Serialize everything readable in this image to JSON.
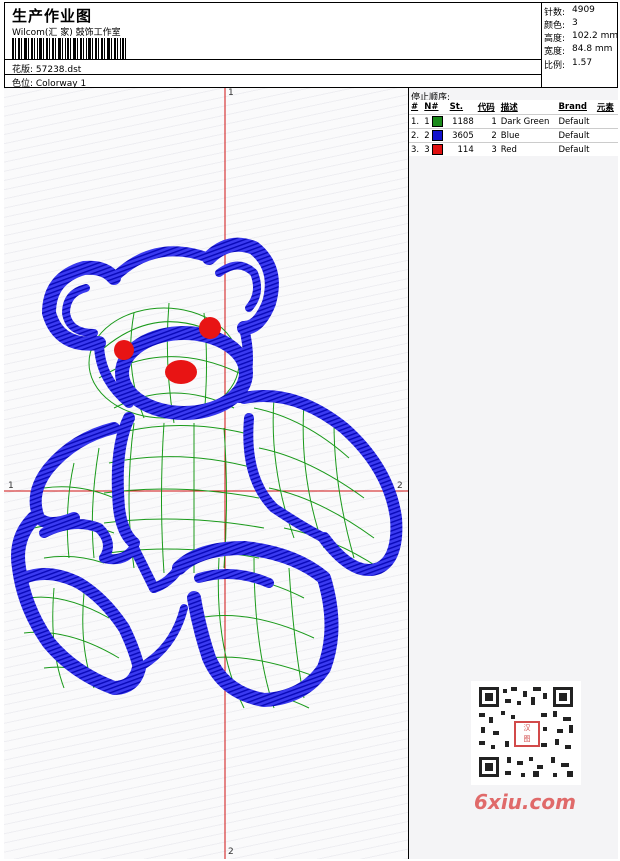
{
  "header": {
    "title": "生产作业图",
    "company": "Wilcom(汇 家) 鼓饰工作室",
    "design_label": "花版: 57238.dst",
    "colorway_label": "色位: Colorway 1"
  },
  "stats": [
    {
      "label": "针数:",
      "value": "4909"
    },
    {
      "label": "颜色:",
      "value": "3"
    },
    {
      "label": "高度:",
      "value": "102.2 mm"
    },
    {
      "label": "宽度:",
      "value": "84.8 mm"
    },
    {
      "label": "比例:",
      "value": "1.57"
    }
  ],
  "markers": {
    "top": "1",
    "left": "1",
    "right": "2",
    "bottom": "2"
  },
  "stop_sequence": {
    "title": "停止顺序:",
    "headers": [
      "#",
      "N#",
      "St.",
      "代码",
      "描述",
      "Brand",
      "元素"
    ],
    "rows": [
      {
        "idx": "1.",
        "n": "1",
        "color": "#1a8a1a",
        "st": "1188",
        "code": "1",
        "desc": "Dark Green",
        "brand": "Default"
      },
      {
        "idx": "2.",
        "n": "2",
        "color": "#1212cc",
        "st": "3605",
        "code": "2",
        "desc": "Blue",
        "brand": "Default"
      },
      {
        "idx": "3.",
        "n": "3",
        "color": "#e01010",
        "st": "114",
        "code": "3",
        "desc": "Red",
        "brand": "Default"
      }
    ]
  },
  "watermark": "6xiu.com",
  "colors": {
    "blue": "#1414e6",
    "green": "#1a9a1a",
    "red": "#e81414",
    "crosshair": "#d01010"
  }
}
